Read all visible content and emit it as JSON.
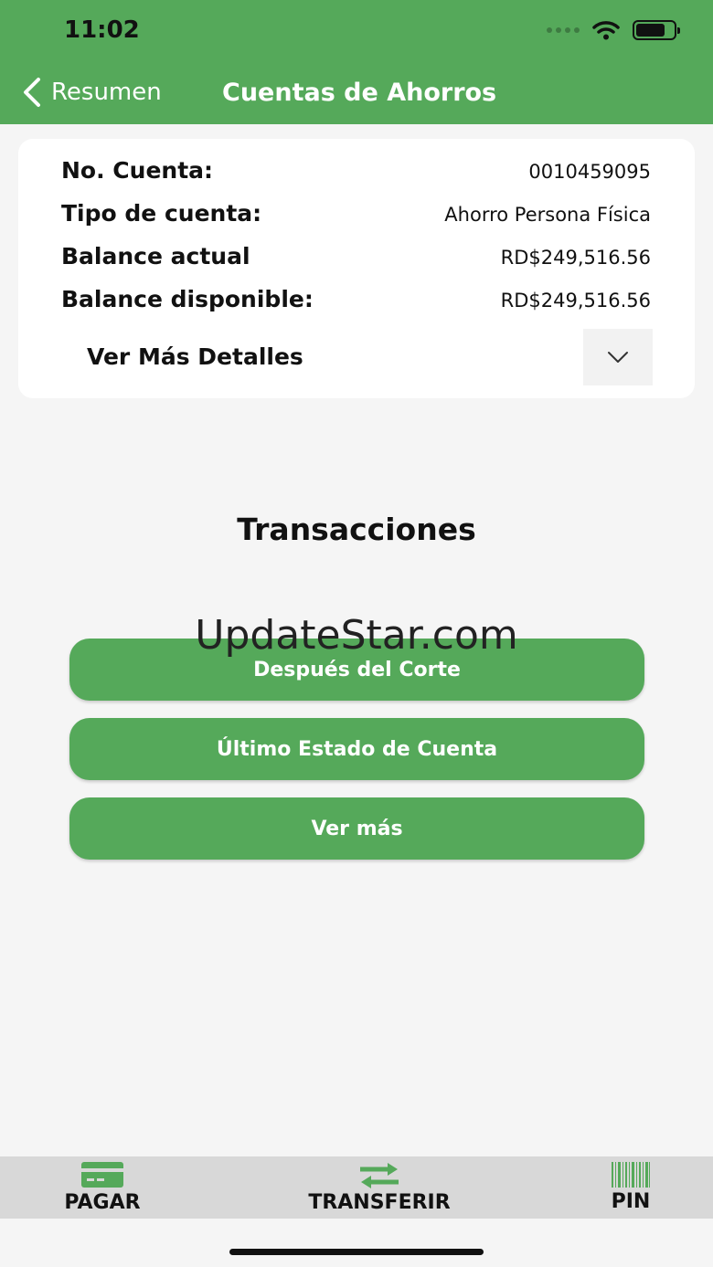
{
  "status_bar": {
    "time": "11:02"
  },
  "nav": {
    "back_label": "Resumen",
    "title": "Cuentas de Ahorros"
  },
  "account": {
    "rows": [
      {
        "label": "No. Cuenta:",
        "value": "0010459095"
      },
      {
        "label": "Tipo de cuenta:",
        "value": "Ahorro Persona Física"
      },
      {
        "label": "Balance actual",
        "value": "RD$249,516.56"
      },
      {
        "label": "Balance disponible:",
        "value": "RD$249,516.56"
      }
    ],
    "details_label": "Ver Más Detalles"
  },
  "transactions": {
    "title": "Transacciones",
    "buttons": [
      "Después del Corte",
      "Último Estado de Cuenta",
      "Ver más"
    ]
  },
  "watermark": "UpdateStar.com",
  "tabbar": {
    "items": [
      {
        "label": "PAGAR",
        "icon": "card-icon"
      },
      {
        "label": "TRANSFERIR",
        "icon": "transfer-arrows-icon"
      },
      {
        "label": "PIN",
        "icon": "barcode-icon"
      }
    ]
  },
  "colors": {
    "brand_green": "#55a95a",
    "background": "#f5f5f5",
    "tabbar": "#d8d8d8"
  }
}
